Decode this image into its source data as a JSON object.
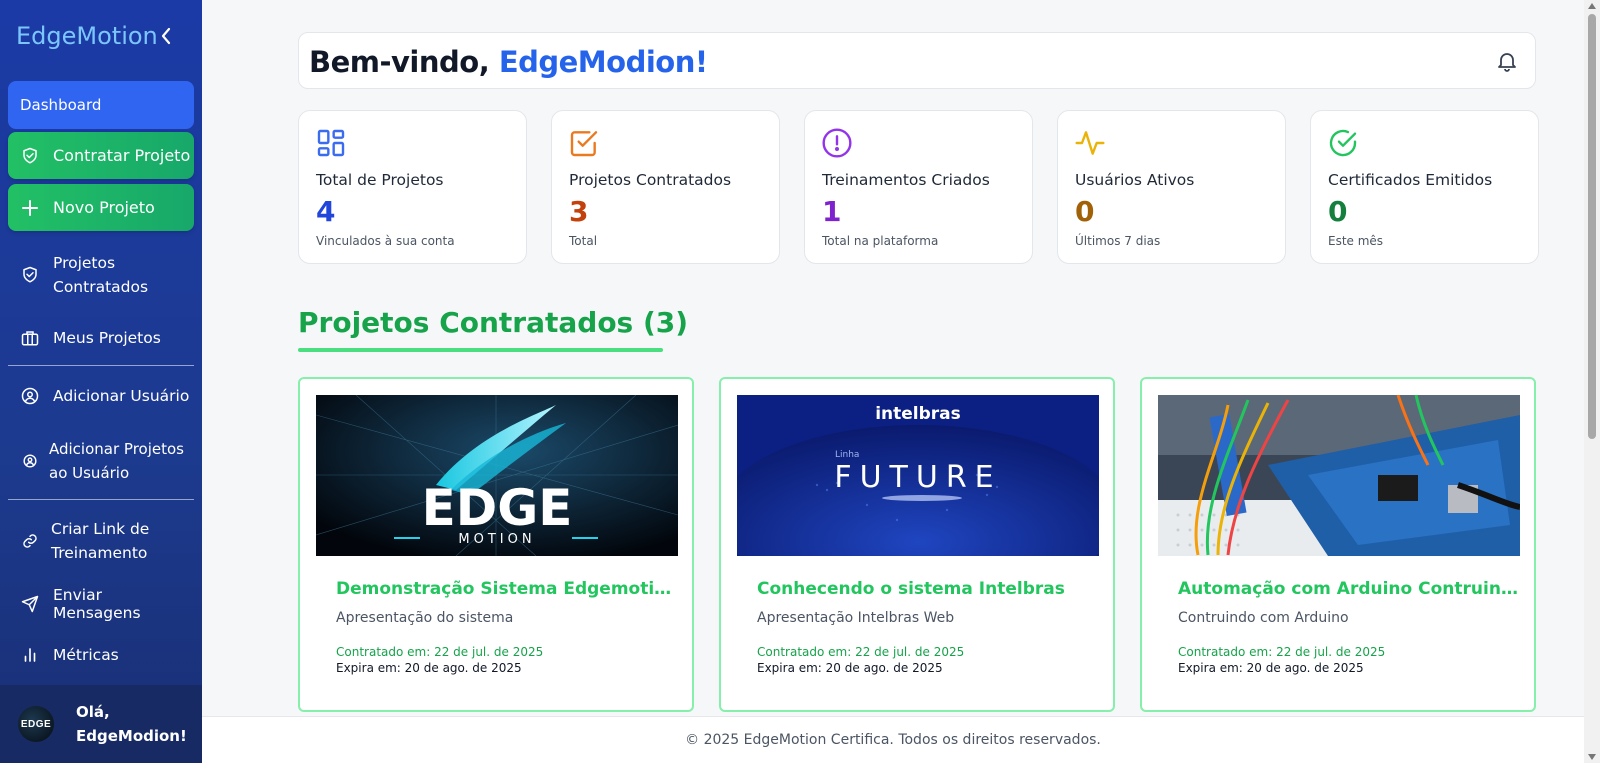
{
  "sidebar": {
    "brand": "EdgeMotion",
    "items": [
      {
        "label": "Dashboard"
      },
      {
        "label": "Contratar Projeto"
      },
      {
        "label": "Novo Projeto"
      },
      {
        "label": "Projetos\nContratados"
      },
      {
        "label": "Meus Projetos"
      },
      {
        "label": "Adicionar Usuário"
      },
      {
        "label": "Adicionar Projetos\nao Usuário"
      },
      {
        "label": "Criar Link de\nTreinamento"
      },
      {
        "label": "Enviar Mensagens"
      },
      {
        "label": "Métricas"
      }
    ],
    "user_greeting": "Olá,\nEdgeModion!",
    "avatar_text": "EDGE"
  },
  "header": {
    "welcome_prefix": "Bem-vindo, ",
    "welcome_name": "EdgeModion!"
  },
  "stats": [
    {
      "label": "Total de Projetos",
      "value": "4",
      "sub": "Vinculados à sua conta",
      "color": "#2246d9",
      "icon": "grid-icon"
    },
    {
      "label": "Projetos Contratados",
      "value": "3",
      "sub": "Total",
      "color": "#c2410c",
      "icon": "checkbox-icon"
    },
    {
      "label": "Treinamentos Criados",
      "value": "1",
      "sub": "Total na plataforma",
      "color": "#7e22ce",
      "icon": "alert-circle-icon"
    },
    {
      "label": "Usuários Ativos",
      "value": "0",
      "sub": "Últimos 7 dias",
      "color": "#a16207",
      "icon": "activity-icon"
    },
    {
      "label": "Certificados Emitidos",
      "value": "0",
      "sub": "Este mês",
      "color": "#15803d",
      "icon": "check-circle-icon"
    }
  ],
  "section": {
    "title": "Projetos Contratados (3)"
  },
  "projects": [
    {
      "title": "Demonstração Sistema Edgemotion",
      "description": "Apresentação do sistema",
      "contracted": "Contratado em: 22 de jul. de 2025",
      "expires": "Expira em: 20 de ago. de 2025",
      "image_text": "EDGE",
      "image_sub": "MOTION"
    },
    {
      "title": "Conhecendo o sistema Intelbras",
      "description": "Apresentação Intelbras Web",
      "contracted": "Contratado em: 22 de jul. de 2025",
      "expires": "Expira em: 20 de ago. de 2025",
      "image_text": "intelbras",
      "image_sub": "Linha",
      "image_main": "FUTURE"
    },
    {
      "title": "Automação com Arduino Contruind...",
      "description": "Contruindo com Arduino",
      "contracted": "Contratado em: 22 de jul. de 2025",
      "expires": "Expira em: 20 de ago. de 2025"
    }
  ],
  "footer": {
    "text": "© 2025 EdgeMotion Certifica. Todos os direitos reservados."
  }
}
